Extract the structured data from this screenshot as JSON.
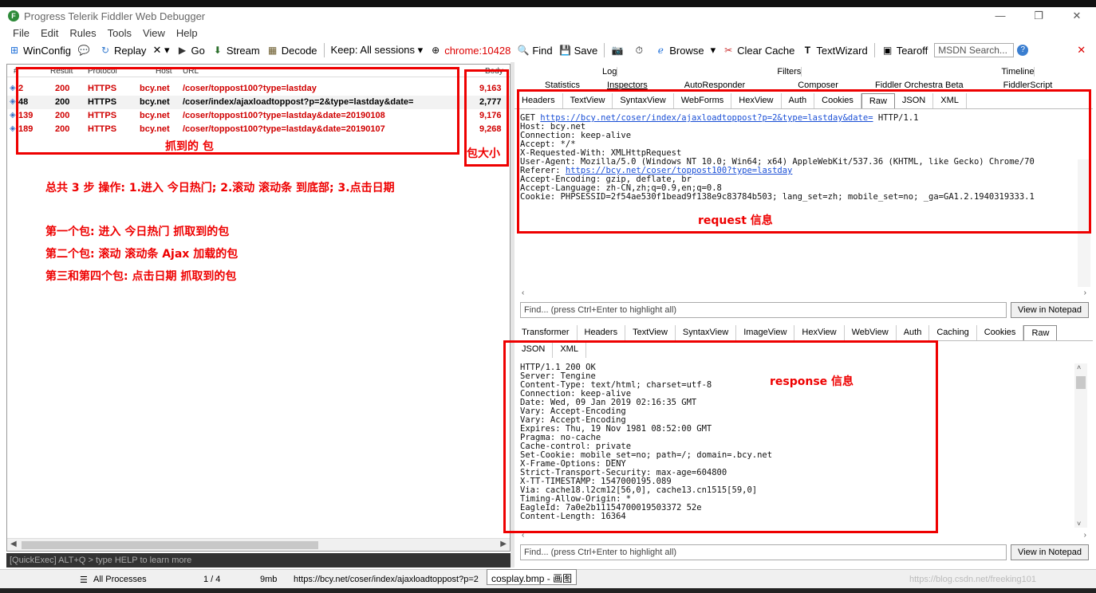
{
  "window": {
    "title": "Progress Telerik Fiddler Web Debugger",
    "icon_letter": "F",
    "controls": [
      "—",
      "❐",
      "✕"
    ]
  },
  "menu": [
    "File",
    "Edit",
    "Rules",
    "Tools",
    "View",
    "Help"
  ],
  "toolbar": {
    "winconfig": "WinConfig",
    "replay": "Replay",
    "remove": "✕ ▾",
    "go": "Go",
    "stream": "Stream",
    "decode": "Decode",
    "keep": "Keep: All sessions ▾",
    "process": "chrome:10428",
    "find": "Find",
    "save": "Save",
    "browse": "Browse",
    "browse_arrow": "▾",
    "clear_cache": "Clear Cache",
    "textwizard": "TextWizard",
    "tearoff": "Tearoff",
    "search_placeholder": "MSDN Search...",
    "close": "✕"
  },
  "sessions": {
    "columns": [
      "#",
      "Result",
      "Protocol",
      "Host",
      "URL",
      "Body"
    ],
    "rows": [
      {
        "id": "2",
        "result": "200",
        "protocol": "HTTPS",
        "host": "bcy.net",
        "url": "/coser/toppost100?type=lastday",
        "body": "9,163",
        "color": "#d00000"
      },
      {
        "id": "48",
        "result": "200",
        "protocol": "HTTPS",
        "host": "bcy.net",
        "url": "/coser/index/ajaxloadtoppost?p=2&type=lastday&date=",
        "body": "2,777",
        "color": "#000000"
      },
      {
        "id": "139",
        "result": "200",
        "protocol": "HTTPS",
        "host": "bcy.net",
        "url": "/coser/toppost100?type=lastday&date=20190108",
        "body": "9,176",
        "color": "#d00000"
      },
      {
        "id": "189",
        "result": "200",
        "protocol": "HTTPS",
        "host": "bcy.net",
        "url": "/coser/toppost100?type=lastday&date=20190107",
        "body": "9,268",
        "color": "#d00000"
      }
    ]
  },
  "annotations": {
    "packets": "抓到的 包",
    "size": "包大小",
    "steps": "总共 3 步 操作: 1.进入 今日热门; 2.滚动 滚动条 到底部; 3.点击日期",
    "first": "第一个包: 进入 今日热门 抓取到的包",
    "second": "第二个包: 滚动 滚动条 Ajax 加载的包",
    "third": "第三和第四个包: 点击日期 抓取到的包",
    "request": "request 信息",
    "response": "response 信息"
  },
  "top_tabs_row1": [
    "Log",
    "Filters",
    "Timeline"
  ],
  "top_tabs_row2": [
    "Statistics",
    "Inspectors",
    "AutoResponder",
    "Composer",
    "Fiddler Orchestra Beta",
    "FiddlerScript"
  ],
  "request_tabs": [
    "Headers",
    "TextView",
    "SyntaxView",
    "WebForms",
    "HexView",
    "Auth",
    "Cookies",
    "Raw",
    "JSON",
    "XML"
  ],
  "request_active_tab": "Raw",
  "request": {
    "line1_prefix": "GET ",
    "line1_url": "https://bcy.net/coser/index/ajaxloadtoppost?p=2&type=lastday&date=",
    "line1_suffix": " HTTP/1.1",
    "host": "Host: bcy.net",
    "connection": "Connection: keep-alive",
    "accept": "Accept: */*",
    "xrw": "X-Requested-With: XMLHttpRequest",
    "ua": "User-Agent: Mozilla/5.0 (Windows NT 10.0; Win64; x64) AppleWebKit/537.36 (KHTML, like Gecko) Chrome/70",
    "referer_prefix": "Referer: ",
    "referer_url": "https://bcy.net/coser/toppost100?type=lastday",
    "enc": "Accept-Encoding: gzip, deflate, br",
    "lang": "Accept-Language: zh-CN,zh;q=0.9,en;q=0.8",
    "cookie": "Cookie: PHPSESSID=2f54ae530f1bead9f138e9c83784b503; lang_set=zh; mobile_set=no; _ga=GA1.2.1940319333.1"
  },
  "find_placeholder": "Find... (press Ctrl+Enter to highlight all)",
  "notepad": "View in Notepad",
  "response_tabs": [
    "Transformer",
    "Headers",
    "TextView",
    "SyntaxView",
    "ImageView",
    "HexView",
    "WebView",
    "Auth",
    "Caching",
    "Cookies",
    "Raw"
  ],
  "response_tabs2": [
    "JSON",
    "XML"
  ],
  "response_active_tab": "Raw",
  "response_lines": [
    "HTTP/1.1 200 OK",
    "Server: Tengine",
    "Content-Type: text/html; charset=utf-8",
    "Connection: keep-alive",
    "Date: Wed, 09 Jan 2019 02:16:35 GMT",
    "Vary: Accept-Encoding",
    "Vary: Accept-Encoding",
    "Expires: Thu, 19 Nov 1981 08:52:00 GMT",
    "Pragma: no-cache",
    "Cache-control: private",
    "Set-Cookie: mobile_set=no; path=/; domain=.bcy.net",
    "X-Frame-Options: DENY",
    "Strict-Transport-Security: max-age=604800",
    "X-TT-TIMESTAMP: 1547000195.089",
    "Via: cache18.l2cm12[56,0], cache13.cn1515[59,0]",
    "Timing-Allow-Origin: *",
    "EagleId: 7a0e2b11154700019503372 52e",
    "Content-Length: 16364"
  ],
  "quickexec": "[QuickExec] ALT+Q > type HELP to learn more",
  "status": {
    "processes": "All Processes",
    "count": "1 / 4",
    "mem": "9mb",
    "url": "https://bcy.net/coser/index/ajaxloadtoppost?p=2",
    "tooltip": "cosplay.bmp - 画图",
    "watermark": "https://blog.csdn.net/freeking101"
  }
}
